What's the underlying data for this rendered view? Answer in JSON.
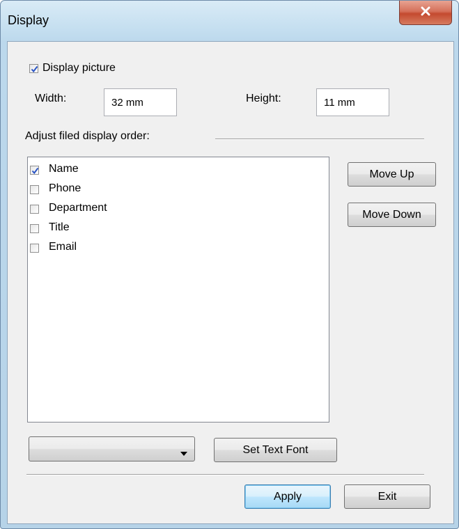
{
  "window": {
    "title": "Display"
  },
  "picture": {
    "checked": true,
    "label": "Display picture"
  },
  "size": {
    "width_label": "Width:",
    "width_value": "32 mm",
    "height_label": "Height:",
    "height_value": "11 mm"
  },
  "order": {
    "section_label": "Adjust filed display order:",
    "items": [
      {
        "label": "Name",
        "checked": true
      },
      {
        "label": "Phone",
        "checked": false
      },
      {
        "label": "Department",
        "checked": false
      },
      {
        "label": "Title",
        "checked": false
      },
      {
        "label": "Email",
        "checked": false
      }
    ],
    "move_up_label": "Move Up",
    "move_down_label": "Move Down"
  },
  "font": {
    "select_value": "",
    "set_font_label": "Set Text Font"
  },
  "footer": {
    "apply_label": "Apply",
    "exit_label": "Exit"
  },
  "icons": {
    "close": "close-icon",
    "check": "checkmark-icon",
    "dropdown": "dropdown-arrow-icon"
  },
  "colors": {
    "title_bar": "#c5dff0",
    "client_bg": "#f0f0f0",
    "close_button": "#c44a2f",
    "check": "#2b55c4"
  }
}
